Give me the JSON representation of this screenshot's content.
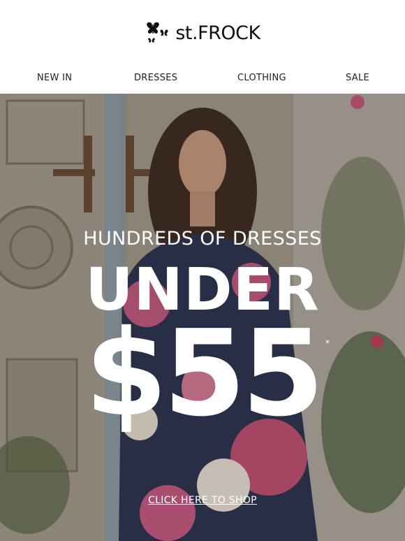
{
  "brand": {
    "name": "st.FROCK",
    "logo_icon": "butterflies-icon"
  },
  "nav": {
    "items": [
      {
        "label": "NEW IN"
      },
      {
        "label": "DRESSES"
      },
      {
        "label": "CLOTHING"
      },
      {
        "label": "SALE"
      }
    ]
  },
  "hero": {
    "subheadline": "HUNDREDS OF DRESSES",
    "headline": "UNDER",
    "price": "$55",
    "asterisk": "*",
    "cta_label": "CLICK HERE TO SHOP"
  },
  "colors": {
    "text_on_image": "#ffffff",
    "nav_text": "#222222",
    "logo": "#111111"
  }
}
